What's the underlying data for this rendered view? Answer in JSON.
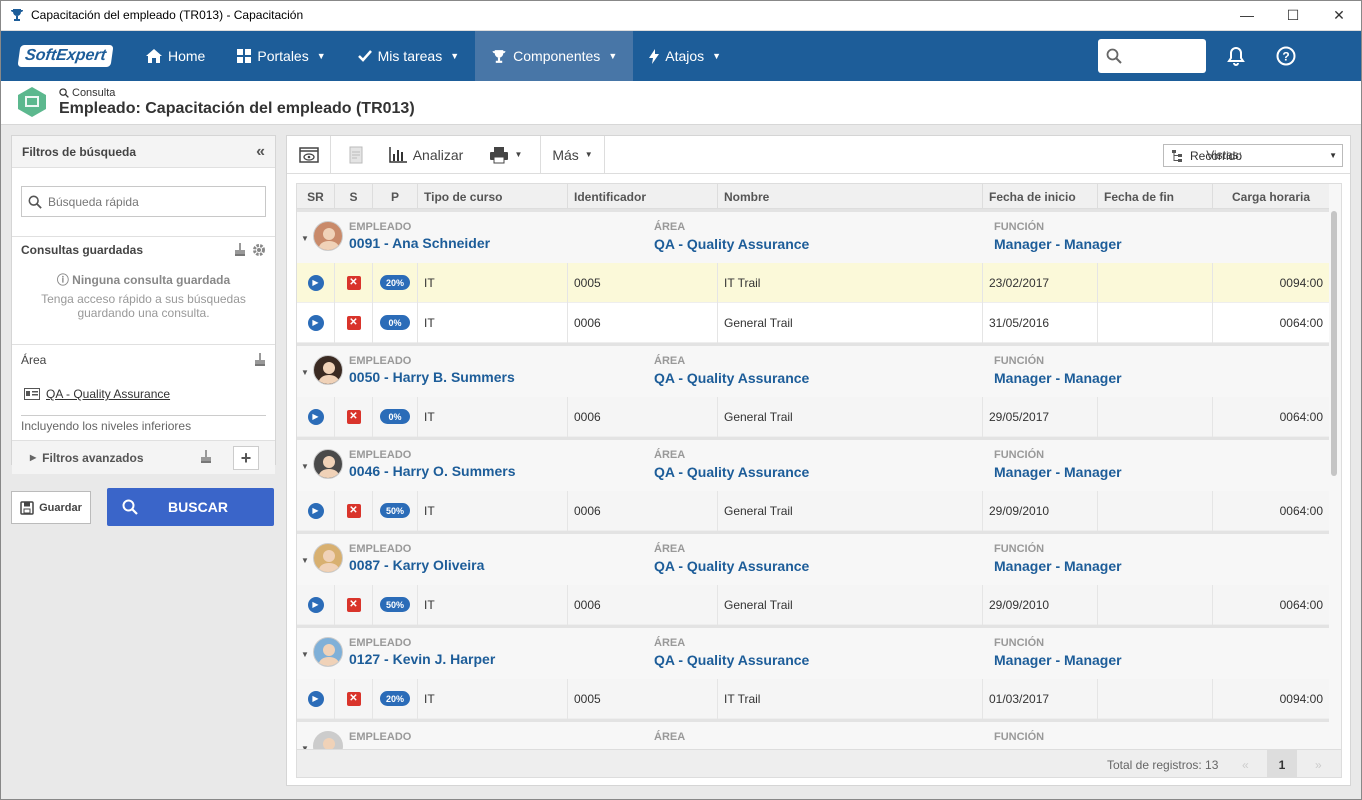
{
  "window": {
    "title": "Capacitación del empleado (TR013) - Capacitación",
    "minimize": "—",
    "maximize": "☐",
    "close": "✕"
  },
  "nav": {
    "logo": "SoftExpert",
    "items": [
      {
        "label": "Home",
        "icon": "home-icon",
        "caret": false
      },
      {
        "label": "Portales",
        "icon": "grid-icon",
        "caret": true
      },
      {
        "label": "Mis tareas",
        "icon": "check-icon",
        "caret": true
      },
      {
        "label": "Componentes",
        "icon": "trophy-icon",
        "caret": true,
        "active": true
      },
      {
        "label": "Atajos",
        "icon": "bolt-icon",
        "caret": true
      }
    ],
    "search_placeholder": ""
  },
  "header": {
    "sub": "Consulta",
    "title": "Empleado: Capacitación del empleado (TR013)"
  },
  "left": {
    "filters_title": "Filtros de búsqueda",
    "quick_search_placeholder": "Búsqueda rápida",
    "saved_title": "Consultas guardadas",
    "saved_empty": "Ninguna consulta guardada",
    "saved_hint": "Tenga acceso rápido a sus búsquedas guardando una consulta.",
    "area_title": "Área",
    "area_item": "QA - Quality Assurance",
    "area_levels": "Incluyendo los niveles inferiores",
    "advanced": "Filtros avanzados",
    "save_button": "Guardar",
    "search_button": "BUSCAR"
  },
  "toolbar": {
    "analyze": "Analizar",
    "more": "Más",
    "views_label": "Vistas:",
    "view_value": "Recorrido"
  },
  "grid": {
    "columns": [
      "SR",
      "S",
      "P",
      "Tipo de curso",
      "Identificador",
      "Nombre",
      "Fecha de inicio",
      "Fecha de fin",
      "Carga horaria"
    ],
    "group_labels": {
      "employee": "EMPLEADO",
      "area": "ÁREA",
      "function": "FUNCIÓN"
    },
    "groups": [
      {
        "employee": "0091 - Ana Schneider",
        "area": "QA - Quality Assurance",
        "function": "Manager - Manager",
        "avatar_color": "#c98a6a",
        "rows": [
          {
            "p": "20%",
            "type": "IT",
            "id": "0005",
            "name": "IT Trail",
            "start": "23/02/2017",
            "end": "",
            "hours": "0094:00",
            "style": "hl"
          },
          {
            "p": "0%",
            "type": "IT",
            "id": "0006",
            "name": "General Trail",
            "start": "31/05/2016",
            "end": "",
            "hours": "0064:00",
            "style": "wh"
          }
        ]
      },
      {
        "employee": "0050 - Harry B. Summers",
        "area": "QA - Quality Assurance",
        "function": "Manager - Manager",
        "avatar_color": "#3a2a22",
        "rows": [
          {
            "p": "0%",
            "type": "IT",
            "id": "0006",
            "name": "General Trail",
            "start": "29/05/2017",
            "end": "",
            "hours": "0064:00",
            "style": ""
          }
        ]
      },
      {
        "employee": "0046 - Harry O. Summers",
        "area": "QA - Quality Assurance",
        "function": "Manager - Manager",
        "avatar_color": "#4a4a4a",
        "rows": [
          {
            "p": "50%",
            "type": "IT",
            "id": "0006",
            "name": "General Trail",
            "start": "29/09/2010",
            "end": "",
            "hours": "0064:00",
            "style": ""
          }
        ]
      },
      {
        "employee": "0087 - Karry Oliveira",
        "area": "QA - Quality Assurance",
        "function": "Manager - Manager",
        "avatar_color": "#d8b070",
        "rows": [
          {
            "p": "50%",
            "type": "IT",
            "id": "0006",
            "name": "General Trail",
            "start": "29/09/2010",
            "end": "",
            "hours": "0064:00",
            "style": ""
          }
        ]
      },
      {
        "employee": "0127 - Kevin J. Harper",
        "area": "QA - Quality Assurance",
        "function": "Manager - Manager",
        "avatar_color": "#7fb0d8",
        "rows": [
          {
            "p": "20%",
            "type": "IT",
            "id": "0005",
            "name": "IT Trail",
            "start": "01/03/2017",
            "end": "",
            "hours": "0094:00",
            "style": ""
          }
        ]
      },
      {
        "employee": "",
        "area": "",
        "function": "",
        "avatar_color": "#cccccc",
        "rows": []
      }
    ],
    "total_label": "Total de registros: 13",
    "page": "1",
    "prev": "«",
    "next": "»"
  }
}
